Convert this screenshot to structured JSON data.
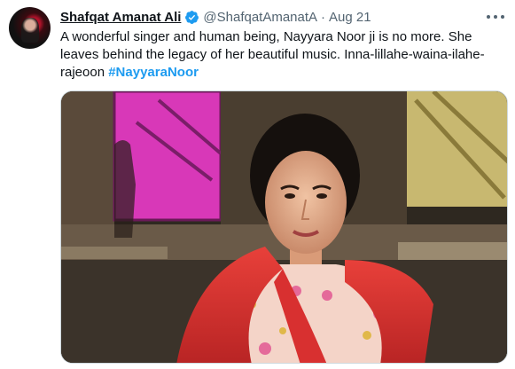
{
  "tweet": {
    "author_name": "Shafqat Amanat Ali",
    "handle": "@ShafqatAmanatA",
    "separator": "·",
    "date": "Aug 21",
    "text_main": "A wonderful singer and human being, Nayyara Noor ji is no more. She leaves behind the legacy of her beautiful music. Inna-lillahe-waina-ilahe-rajeoon ",
    "hashtag": "#NayyaraNoor"
  },
  "icons": {
    "verified": "verified-badge-icon",
    "more": "more-options-icon"
  },
  "colors": {
    "accent": "#1d9bf0",
    "text": "#0f1419",
    "secondary": "#536471"
  }
}
